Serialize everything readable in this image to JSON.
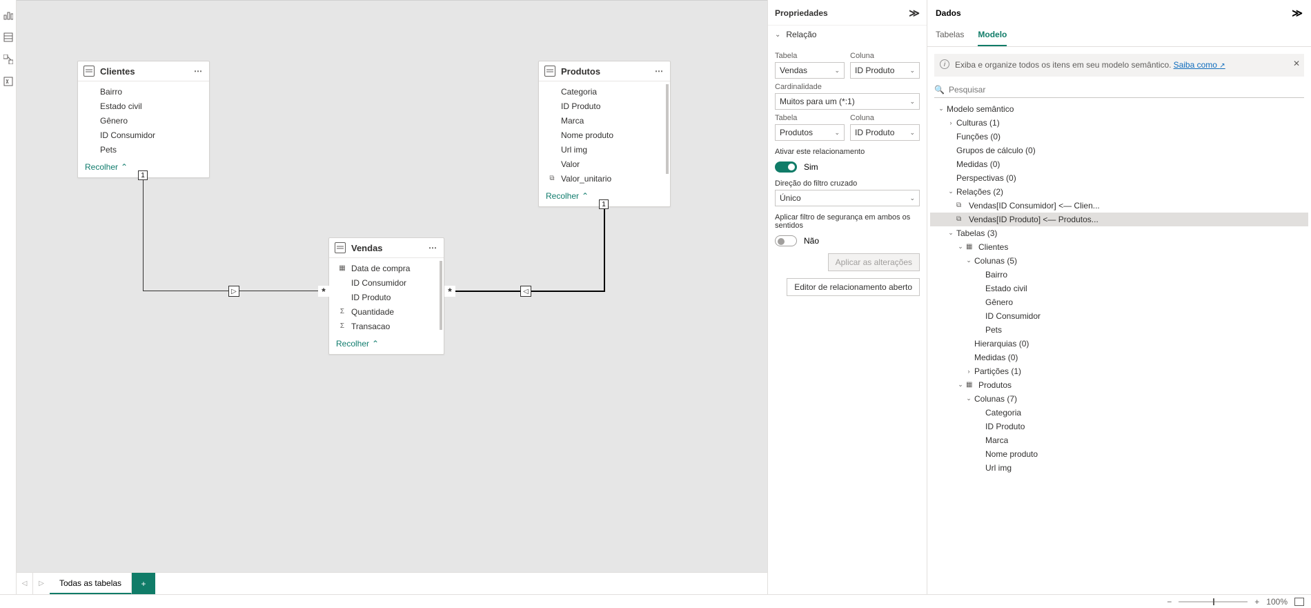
{
  "left_rail": {
    "icons": [
      "bar-chart-icon",
      "table-icon",
      "model-icon",
      "dax-icon"
    ]
  },
  "canvas": {
    "entities": {
      "clientes": {
        "title": "Clientes",
        "fields": [
          {
            "icon": "",
            "label": "Bairro"
          },
          {
            "icon": "",
            "label": "Estado civil"
          },
          {
            "icon": "",
            "label": "Gênero"
          },
          {
            "icon": "",
            "label": "ID Consumidor"
          },
          {
            "icon": "",
            "label": "Pets"
          }
        ],
        "collapse": "Recolher"
      },
      "produtos": {
        "title": "Produtos",
        "fields": [
          {
            "icon": "",
            "label": "Categoria"
          },
          {
            "icon": "",
            "label": "ID Produto"
          },
          {
            "icon": "",
            "label": "Marca"
          },
          {
            "icon": "",
            "label": "Nome produto"
          },
          {
            "icon": "",
            "label": "Url img"
          },
          {
            "icon": "",
            "label": "Valor"
          },
          {
            "icon": "fx",
            "label": "Valor_unitario"
          }
        ],
        "collapse": "Recolher"
      },
      "vendas": {
        "title": "Vendas",
        "fields": [
          {
            "icon": "cal",
            "label": "Data de compra"
          },
          {
            "icon": "",
            "label": "ID Consumidor"
          },
          {
            "icon": "",
            "label": "ID Produto"
          },
          {
            "icon": "sum",
            "label": "Quantidade"
          },
          {
            "icon": "sum",
            "label": "Transacao"
          }
        ],
        "collapse": "Recolher"
      }
    },
    "markers": {
      "one": "1",
      "many": "*",
      "arrow_r": "▷",
      "arrow_l": "◁"
    }
  },
  "tabs": {
    "all_tables": "Todas as tabelas",
    "add": "+"
  },
  "props": {
    "title": "Propriedades",
    "section": "Relação",
    "labels": {
      "table": "Tabela",
      "column": "Coluna",
      "cardinality": "Cardinalidade",
      "activate": "Ativar este relacionamento",
      "cross": "Direção do filtro cruzado",
      "apply_both": "Aplicar filtro de segurança em ambos os sentidos"
    },
    "values": {
      "table1": "Vendas",
      "col1": "ID Produto",
      "cardinality": "Muitos para um (*:1)",
      "table2": "Produtos",
      "col2": "ID Produto",
      "activate": "Sim",
      "cross": "Único",
      "apply_both": "Não"
    },
    "buttons": {
      "apply": "Aplicar as alterações",
      "editor": "Editor de relacionamento aberto"
    }
  },
  "data": {
    "title": "Dados",
    "tabs": {
      "tables": "Tabelas",
      "model": "Modelo"
    },
    "info": {
      "text": "Exiba e organize todos os itens em seu modelo semântico.",
      "link": "Saiba como",
      "ext": "↗"
    },
    "search_placeholder": "Pesquisar",
    "tree": {
      "root": "Modelo semântico",
      "cultures": "Culturas (1)",
      "roles": "Funções (0)",
      "calc_groups": "Grupos de cálculo (0)",
      "measures": "Medidas (0)",
      "perspectives": "Perspectivas (0)",
      "relations": "Relações (2)",
      "rel1": "Vendas[ID Consumidor] <— Clien...",
      "rel2": "Vendas[ID Produto] <— Produtos...",
      "tables": "Tabelas (3)",
      "t_clientes": "Clientes",
      "t_clientes_cols": "Colunas (5)",
      "c1": "Bairro",
      "c2": "Estado civil",
      "c3": "Gênero",
      "c4": "ID Consumidor",
      "c5": "Pets",
      "hier": "Hierarquias (0)",
      "meas2": "Medidas (0)",
      "parts": "Partições (1)",
      "t_produtos": "Produtos",
      "t_produtos_cols": "Colunas (7)",
      "p1": "Categoria",
      "p2": "ID Produto",
      "p3": "Marca",
      "p4": "Nome produto",
      "p5": "Url img"
    }
  },
  "status": {
    "zoom": "100%",
    "minus": "−",
    "plus": "+"
  }
}
